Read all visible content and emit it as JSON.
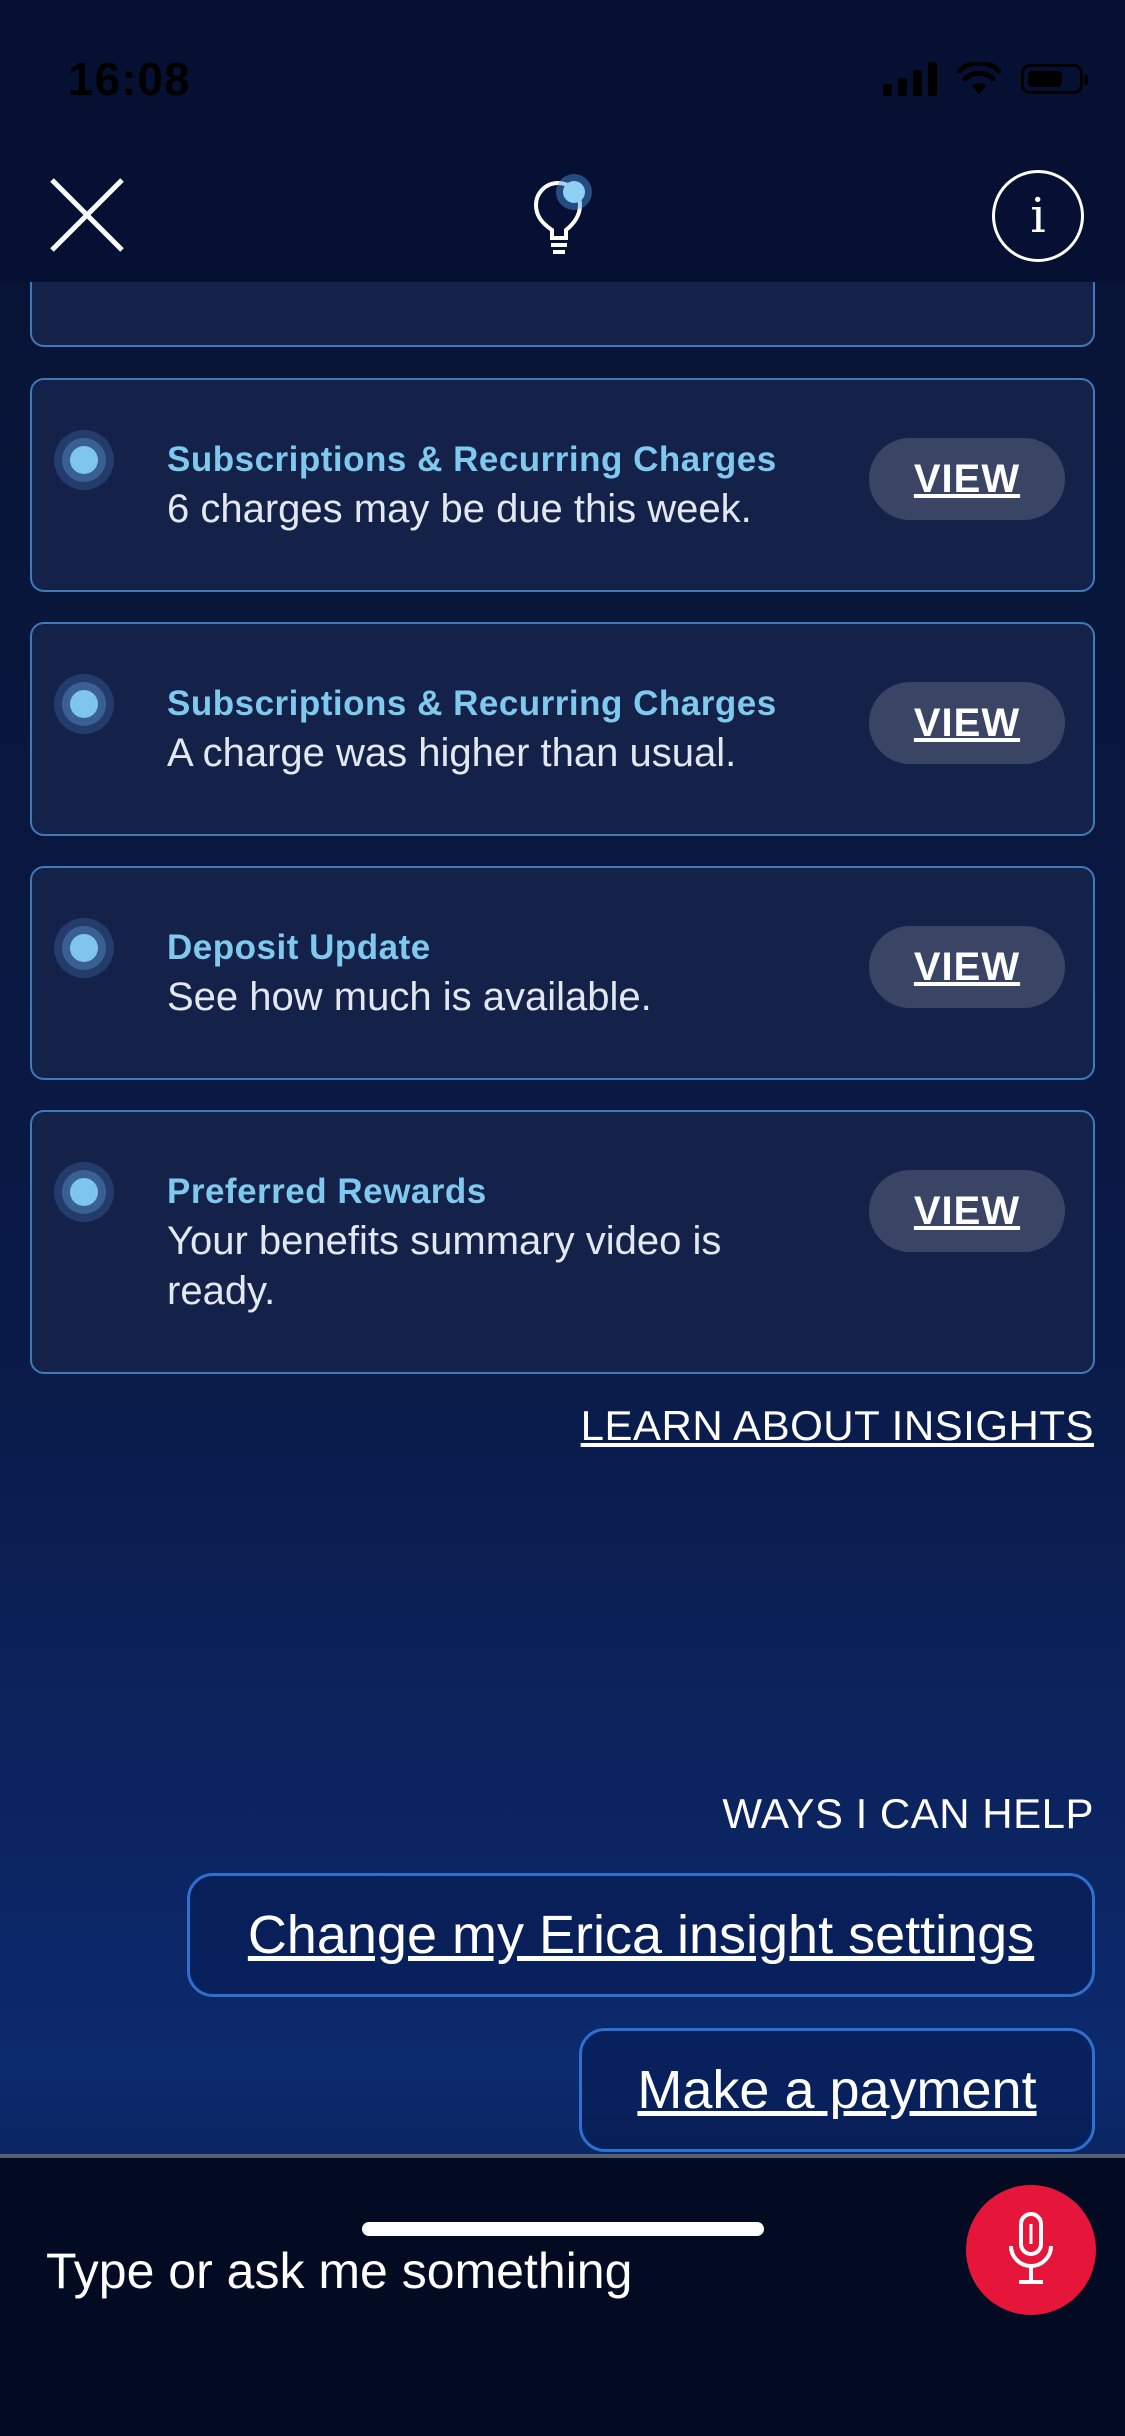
{
  "status_bar": {
    "time": "16:08"
  },
  "header": {
    "close_icon": "close-icon",
    "center_icon": "lightbulb-icon",
    "info_icon": "info-icon"
  },
  "insights": [
    {
      "title": "Subscriptions & Recurring Charges",
      "description": "6 charges may be due this week.",
      "action": "VIEW"
    },
    {
      "title": "Subscriptions & Recurring Charges",
      "description": "A charge was higher than usual.",
      "action": "VIEW"
    },
    {
      "title": "Deposit Update",
      "description": "See how much is available.",
      "action": "VIEW"
    },
    {
      "title": "Preferred Rewards",
      "description": "Your benefits summary video is ready.",
      "action": "VIEW"
    }
  ],
  "learn_link": "LEARN ABOUT INSIGHTS",
  "help": {
    "heading": "WAYS I CAN HELP",
    "suggestions": [
      "Change my Erica insight settings",
      "Make a payment"
    ]
  },
  "input": {
    "placeholder": "Type or ask me something",
    "mic_icon": "microphone-icon"
  },
  "colors": {
    "accent_title": "#7fc8ee",
    "card_border": "#3f79b8",
    "mic_button": "#e5163a",
    "background": "#071232"
  }
}
